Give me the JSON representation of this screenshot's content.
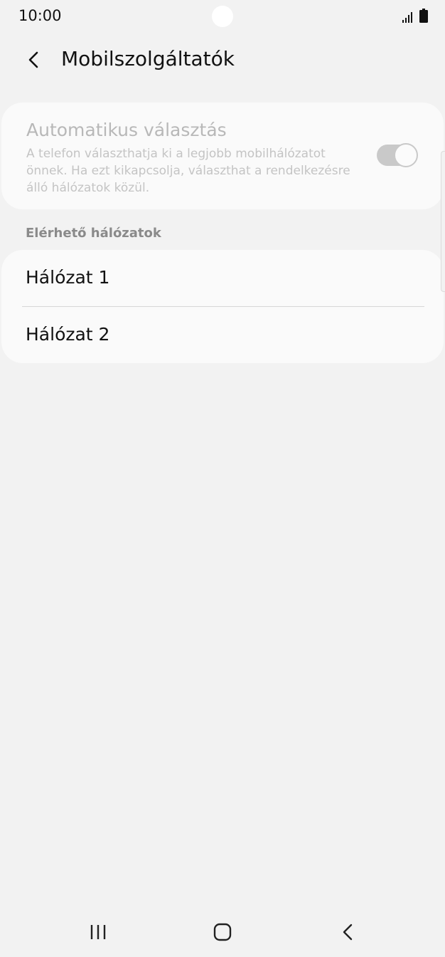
{
  "status_bar": {
    "time": "10:00",
    "icons": [
      "signal-icon",
      "battery-icon"
    ]
  },
  "header": {
    "title": "Mobilszolgáltatók",
    "back_icon": "back-arrow-icon"
  },
  "auto_select": {
    "title": "Automatikus választás",
    "description": "A telefon választhatja ki a legjobb mobilhálózatot önnek. Ha ezt kikapcsolja, választhat a rendelkezésre álló hálózatok közül.",
    "toggle_on": true,
    "enabled": false
  },
  "available_networks": {
    "label": "Elérhető hálózatok",
    "items": [
      {
        "label": "Hálózat 1"
      },
      {
        "label": "Hálózat 2"
      }
    ]
  },
  "nav_bar": {
    "icons": [
      "recents-icon",
      "home-icon",
      "back-icon"
    ]
  },
  "colors": {
    "background": "#f2f2f2",
    "card": "#fafafa",
    "disabled_text": "#b8b8b8",
    "toggle_disabled": "#c9c9c9"
  }
}
